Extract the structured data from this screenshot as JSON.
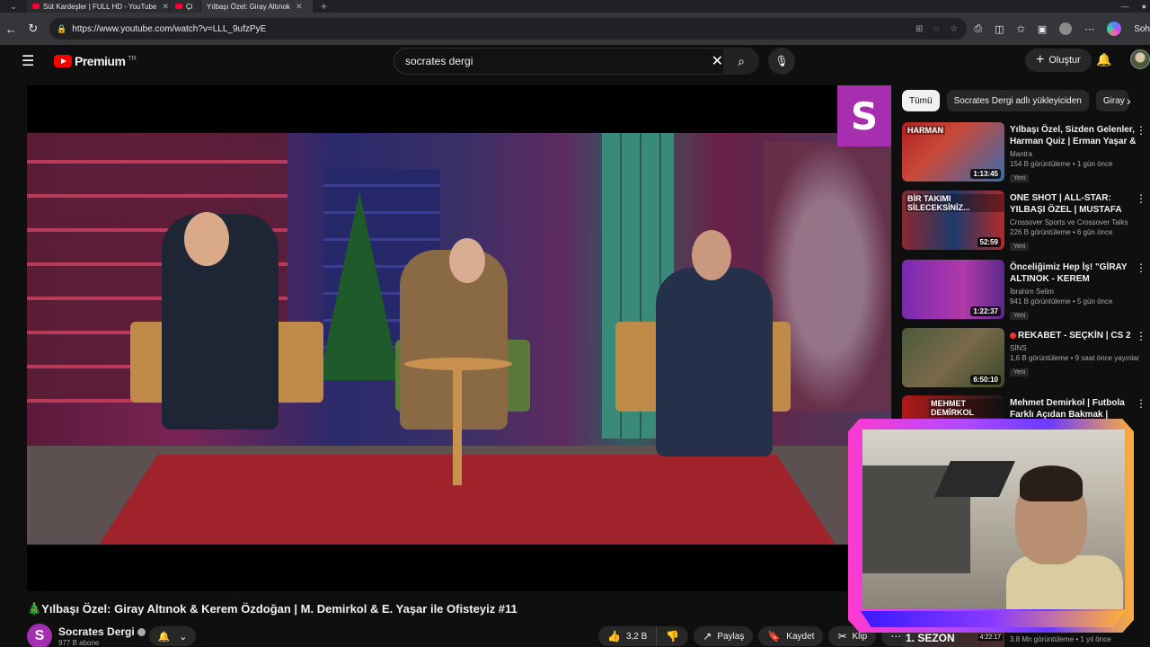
{
  "browser": {
    "tabs": [
      {
        "label": "Süt Kardeşler | FULL HD - YouTube",
        "active": false
      },
      {
        "label": "Çi",
        "active": false
      },
      {
        "label": "Yılbaşı Özel: Giray Altınok",
        "active": true
      }
    ],
    "url": "https://www.youtube.com/watch?v=LLL_9ufzPyE",
    "profile_label": "Soh"
  },
  "header": {
    "logo_text": "Premium",
    "logo_region": "TR",
    "search_query": "socrates dergi",
    "create_label": "Oluştur"
  },
  "video": {
    "title": "🎄Yılbaşı Özel: Giray Altınok & Kerem Özdoğan | M. Demirkol & E. Yaşar ile Ofisteyiz #11",
    "channel_badge": "S",
    "channel_name": "Socrates Dergi",
    "subscribers": "977 B abone",
    "likes": "3,2 B",
    "share_label": "Paylaş",
    "save_label": "Kaydet",
    "clip_label": "Klip"
  },
  "chips": [
    "Tümü",
    "Socrates Dergi adlı yükleyiciden",
    "Giray"
  ],
  "recommendations": [
    {
      "title": "Yılbaşı Özel, Sizden Gelenler, Harman Quiz | Erman Yaşar & ...",
      "channel": "Mantra",
      "stats": "154 B görüntüleme • 1 gün önce",
      "badge": "Yeni",
      "duration": "1:13:45",
      "thumb_text": "HARMAN",
      "live": false
    },
    {
      "title": "ONE SHOT | ALL-STAR: YILBAŞI ÖZEL | MUSTAFA DEMİRTAŞ, ...",
      "channel": "Crossover Sports ve Crossover Talks",
      "stats": "226 B görüntüleme • 6 gün önce",
      "badge": "Yeni",
      "duration": "52:59",
      "thumb_text": "BİR TAKIMI SİLECEKSİNİZ...",
      "live": false
    },
    {
      "title": "Önceliğimiz Hep İş! \"GİRAY ALTINOK - KEREM ÖZDOĞAN\" ...",
      "channel": "İbrahim Selim",
      "stats": "941 B görüntüleme • 5 gün önce",
      "badge": "Yeni",
      "duration": "1:22:37",
      "thumb_text": "",
      "live": false
    },
    {
      "title": "REKABET - SEÇKİN | CS 2",
      "channel": "SİNS",
      "stats": "1,6 B görüntüleme • 9 saat önce yayınlan...",
      "badge": "Yeni",
      "duration": "6:50:10",
      "thumb_text": "",
      "live": true
    },
    {
      "title": "Mehmet Demirkol | Futbola Farklı Açıdan Bakmak | Kimsin...",
      "channel": "",
      "stats": "",
      "badge": "",
      "duration": "",
      "thumb_text": "MEHMET DEMİRKOL",
      "live": false
    }
  ],
  "bottom_rec": {
    "thumb_text": "1. SEZON",
    "duration": "4:22:17",
    "stats": "3,8 Mn görüntüleme • 1 yıl önce"
  }
}
